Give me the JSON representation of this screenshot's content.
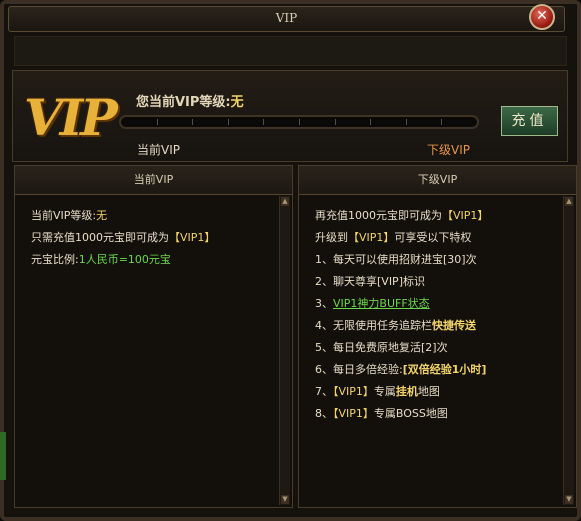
{
  "window": {
    "title": "VIP",
    "close_glyph": "✕"
  },
  "header": {
    "logo_text": "VIP",
    "level_label": "您当前VIP等级:",
    "level_value": "无",
    "progress_fraction": 0,
    "progress_segments": 10,
    "recharge_label": "充值",
    "current_label": "当前VIP",
    "next_label": "下级VIP"
  },
  "left_panel": {
    "title": "当前VIP",
    "lines": [
      "当前VIP等级:",
      "无",
      "只需充值1000元宝即可成为",
      "【VIP1】",
      "元宝比例:",
      "1人民币=100元宝"
    ]
  },
  "right_panel": {
    "title": "下级VIP",
    "lines": [
      "再充值1000元宝即可成为",
      "【VIP1】",
      "升级到",
      "【VIP1】",
      "可享受以下特权",
      "1、每天可以使用招财进宝[30]次",
      "2、聊天尊享[VIP]标识",
      "3、",
      "VIP1神力BUFF状态",
      "4、无限使用任务追踪栏",
      "快捷传送",
      "5、每日免费原地复活[2]次",
      "6、每日多倍经验:",
      "[双倍经验1小时]",
      "7、",
      "【VIP1】",
      "专属",
      "挂机",
      "地图",
      "8、",
      "【VIP1】",
      "专属BOSS地图"
    ]
  },
  "colors": {
    "accent_gold": "#f2d46a",
    "green": "#6ad64a",
    "orange": "#e39548"
  }
}
